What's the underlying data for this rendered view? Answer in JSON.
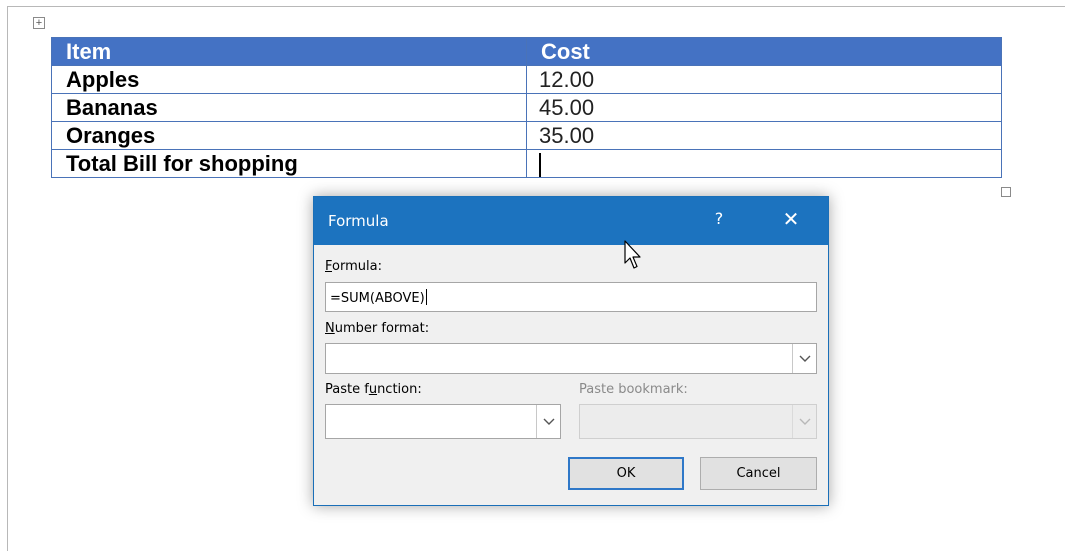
{
  "table": {
    "headers": [
      "Item",
      "Cost"
    ],
    "rows": [
      {
        "item": "Apples",
        "cost": "12.00"
      },
      {
        "item": "Bananas",
        "cost": "45.00"
      },
      {
        "item": "Oranges",
        "cost": "35.00"
      },
      {
        "item": "Total Bill for shopping",
        "cost": ""
      }
    ]
  },
  "dialog": {
    "title": "Formula",
    "help": "?",
    "close": "✕",
    "formula": {
      "label_prefix": "F",
      "label_rest": "ormula:",
      "value": "=SUM(ABOVE)"
    },
    "number_format": {
      "label_prefix": "N",
      "label_rest": "umber format:",
      "value": ""
    },
    "paste_function": {
      "label_pre": "Paste f",
      "label_u": "u",
      "label_post": "nction:",
      "value": ""
    },
    "paste_bookmark": {
      "label": "Paste bookmark:",
      "value": ""
    },
    "ok": "OK",
    "cancel": "Cancel"
  },
  "colors": {
    "header_bg": "#4472c4",
    "titlebar": "#1c73bf"
  },
  "icons": {
    "move_handle": "table-move-handle-icon",
    "dropdown": "chevron-down-icon",
    "cursor": "mouse-pointer-icon"
  }
}
